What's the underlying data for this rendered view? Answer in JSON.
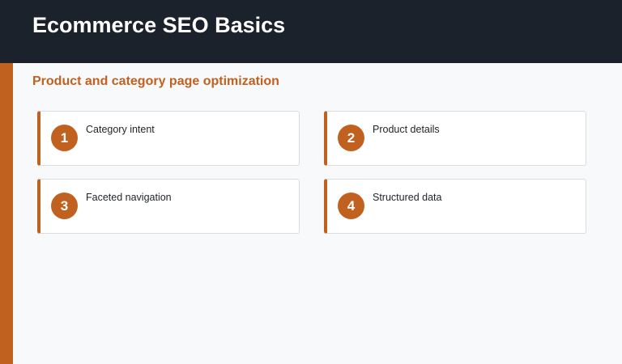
{
  "header": {
    "title": "Ecommerce SEO Basics"
  },
  "section": {
    "heading": "Product and category page optimization"
  },
  "cards": [
    {
      "number": "1",
      "label": "Category intent"
    },
    {
      "number": "2",
      "label": "Product details"
    },
    {
      "number": "3",
      "label": "Faceted navigation"
    },
    {
      "number": "4",
      "label": "Structured data"
    }
  ],
  "colors": {
    "header_background": "#1b222b",
    "accent": "#c1611f",
    "page_background": "#f7f9fb",
    "card_background": "#ffffff"
  }
}
